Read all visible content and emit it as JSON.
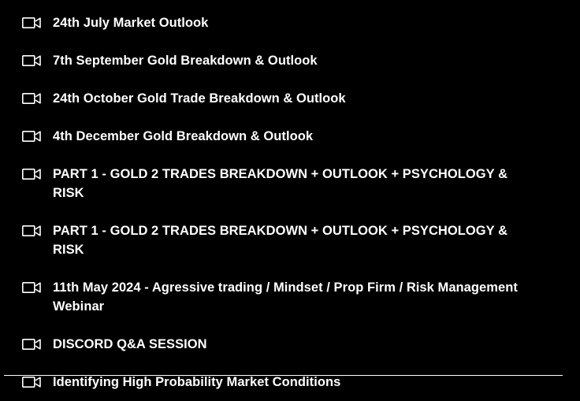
{
  "colors": {
    "background": "#000000",
    "text": "#ffffff",
    "icon": "#ffffff"
  },
  "lessons": [
    {
      "icon": "video-camera-icon",
      "title": "24th July Market Outlook"
    },
    {
      "icon": "video-camera-icon",
      "title": "7th September Gold Breakdown & Outlook"
    },
    {
      "icon": "video-camera-icon",
      "title": "24th October Gold Trade Breakdown & Outlook"
    },
    {
      "icon": "video-camera-icon",
      "title": "4th December Gold Breakdown & Outlook"
    },
    {
      "icon": "video-camera-icon",
      "title": "PART 1 - GOLD 2 TRADES BREAKDOWN + OUTLOOK + PSYCHOLOGY & RISK"
    },
    {
      "icon": "video-camera-icon",
      "title": "PART 1 - GOLD 2 TRADES BREAKDOWN + OUTLOOK + PSYCHOLOGY & RISK"
    },
    {
      "icon": "video-camera-icon",
      "title": "11th May 2024 - Agressive trading / Mindset / Prop Firm / Risk Management Webinar"
    },
    {
      "icon": "video-camera-icon",
      "title": "DISCORD Q&A SESSION"
    },
    {
      "icon": "video-camera-icon",
      "title": "Identifying High Probability Market Conditions"
    }
  ]
}
